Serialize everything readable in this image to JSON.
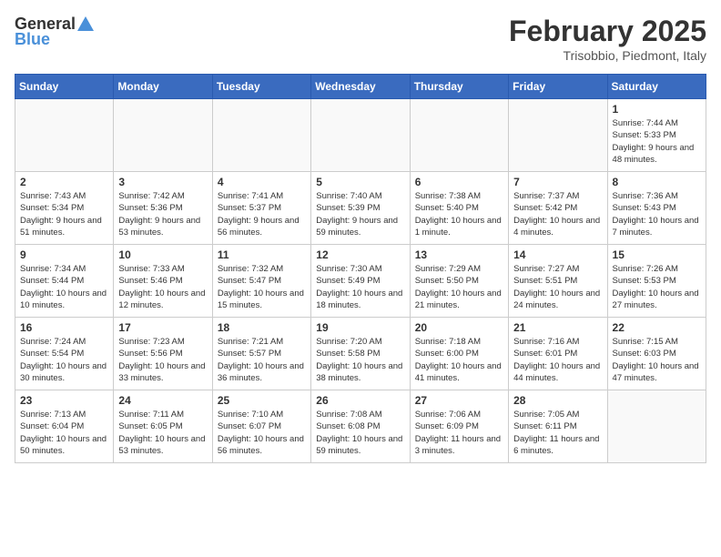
{
  "header": {
    "logo_general": "General",
    "logo_blue": "Blue",
    "month_title": "February 2025",
    "location": "Trisobbio, Piedmont, Italy"
  },
  "weekdays": [
    "Sunday",
    "Monday",
    "Tuesday",
    "Wednesday",
    "Thursday",
    "Friday",
    "Saturday"
  ],
  "weeks": [
    [
      {
        "day": "",
        "info": ""
      },
      {
        "day": "",
        "info": ""
      },
      {
        "day": "",
        "info": ""
      },
      {
        "day": "",
        "info": ""
      },
      {
        "day": "",
        "info": ""
      },
      {
        "day": "",
        "info": ""
      },
      {
        "day": "1",
        "info": "Sunrise: 7:44 AM\nSunset: 5:33 PM\nDaylight: 9 hours and 48 minutes."
      }
    ],
    [
      {
        "day": "2",
        "info": "Sunrise: 7:43 AM\nSunset: 5:34 PM\nDaylight: 9 hours and 51 minutes."
      },
      {
        "day": "3",
        "info": "Sunrise: 7:42 AM\nSunset: 5:36 PM\nDaylight: 9 hours and 53 minutes."
      },
      {
        "day": "4",
        "info": "Sunrise: 7:41 AM\nSunset: 5:37 PM\nDaylight: 9 hours and 56 minutes."
      },
      {
        "day": "5",
        "info": "Sunrise: 7:40 AM\nSunset: 5:39 PM\nDaylight: 9 hours and 59 minutes."
      },
      {
        "day": "6",
        "info": "Sunrise: 7:38 AM\nSunset: 5:40 PM\nDaylight: 10 hours and 1 minute."
      },
      {
        "day": "7",
        "info": "Sunrise: 7:37 AM\nSunset: 5:42 PM\nDaylight: 10 hours and 4 minutes."
      },
      {
        "day": "8",
        "info": "Sunrise: 7:36 AM\nSunset: 5:43 PM\nDaylight: 10 hours and 7 minutes."
      }
    ],
    [
      {
        "day": "9",
        "info": "Sunrise: 7:34 AM\nSunset: 5:44 PM\nDaylight: 10 hours and 10 minutes."
      },
      {
        "day": "10",
        "info": "Sunrise: 7:33 AM\nSunset: 5:46 PM\nDaylight: 10 hours and 12 minutes."
      },
      {
        "day": "11",
        "info": "Sunrise: 7:32 AM\nSunset: 5:47 PM\nDaylight: 10 hours and 15 minutes."
      },
      {
        "day": "12",
        "info": "Sunrise: 7:30 AM\nSunset: 5:49 PM\nDaylight: 10 hours and 18 minutes."
      },
      {
        "day": "13",
        "info": "Sunrise: 7:29 AM\nSunset: 5:50 PM\nDaylight: 10 hours and 21 minutes."
      },
      {
        "day": "14",
        "info": "Sunrise: 7:27 AM\nSunset: 5:51 PM\nDaylight: 10 hours and 24 minutes."
      },
      {
        "day": "15",
        "info": "Sunrise: 7:26 AM\nSunset: 5:53 PM\nDaylight: 10 hours and 27 minutes."
      }
    ],
    [
      {
        "day": "16",
        "info": "Sunrise: 7:24 AM\nSunset: 5:54 PM\nDaylight: 10 hours and 30 minutes."
      },
      {
        "day": "17",
        "info": "Sunrise: 7:23 AM\nSunset: 5:56 PM\nDaylight: 10 hours and 33 minutes."
      },
      {
        "day": "18",
        "info": "Sunrise: 7:21 AM\nSunset: 5:57 PM\nDaylight: 10 hours and 36 minutes."
      },
      {
        "day": "19",
        "info": "Sunrise: 7:20 AM\nSunset: 5:58 PM\nDaylight: 10 hours and 38 minutes."
      },
      {
        "day": "20",
        "info": "Sunrise: 7:18 AM\nSunset: 6:00 PM\nDaylight: 10 hours and 41 minutes."
      },
      {
        "day": "21",
        "info": "Sunrise: 7:16 AM\nSunset: 6:01 PM\nDaylight: 10 hours and 44 minutes."
      },
      {
        "day": "22",
        "info": "Sunrise: 7:15 AM\nSunset: 6:03 PM\nDaylight: 10 hours and 47 minutes."
      }
    ],
    [
      {
        "day": "23",
        "info": "Sunrise: 7:13 AM\nSunset: 6:04 PM\nDaylight: 10 hours and 50 minutes."
      },
      {
        "day": "24",
        "info": "Sunrise: 7:11 AM\nSunset: 6:05 PM\nDaylight: 10 hours and 53 minutes."
      },
      {
        "day": "25",
        "info": "Sunrise: 7:10 AM\nSunset: 6:07 PM\nDaylight: 10 hours and 56 minutes."
      },
      {
        "day": "26",
        "info": "Sunrise: 7:08 AM\nSunset: 6:08 PM\nDaylight: 10 hours and 59 minutes."
      },
      {
        "day": "27",
        "info": "Sunrise: 7:06 AM\nSunset: 6:09 PM\nDaylight: 11 hours and 3 minutes."
      },
      {
        "day": "28",
        "info": "Sunrise: 7:05 AM\nSunset: 6:11 PM\nDaylight: 11 hours and 6 minutes."
      },
      {
        "day": "",
        "info": ""
      }
    ]
  ]
}
